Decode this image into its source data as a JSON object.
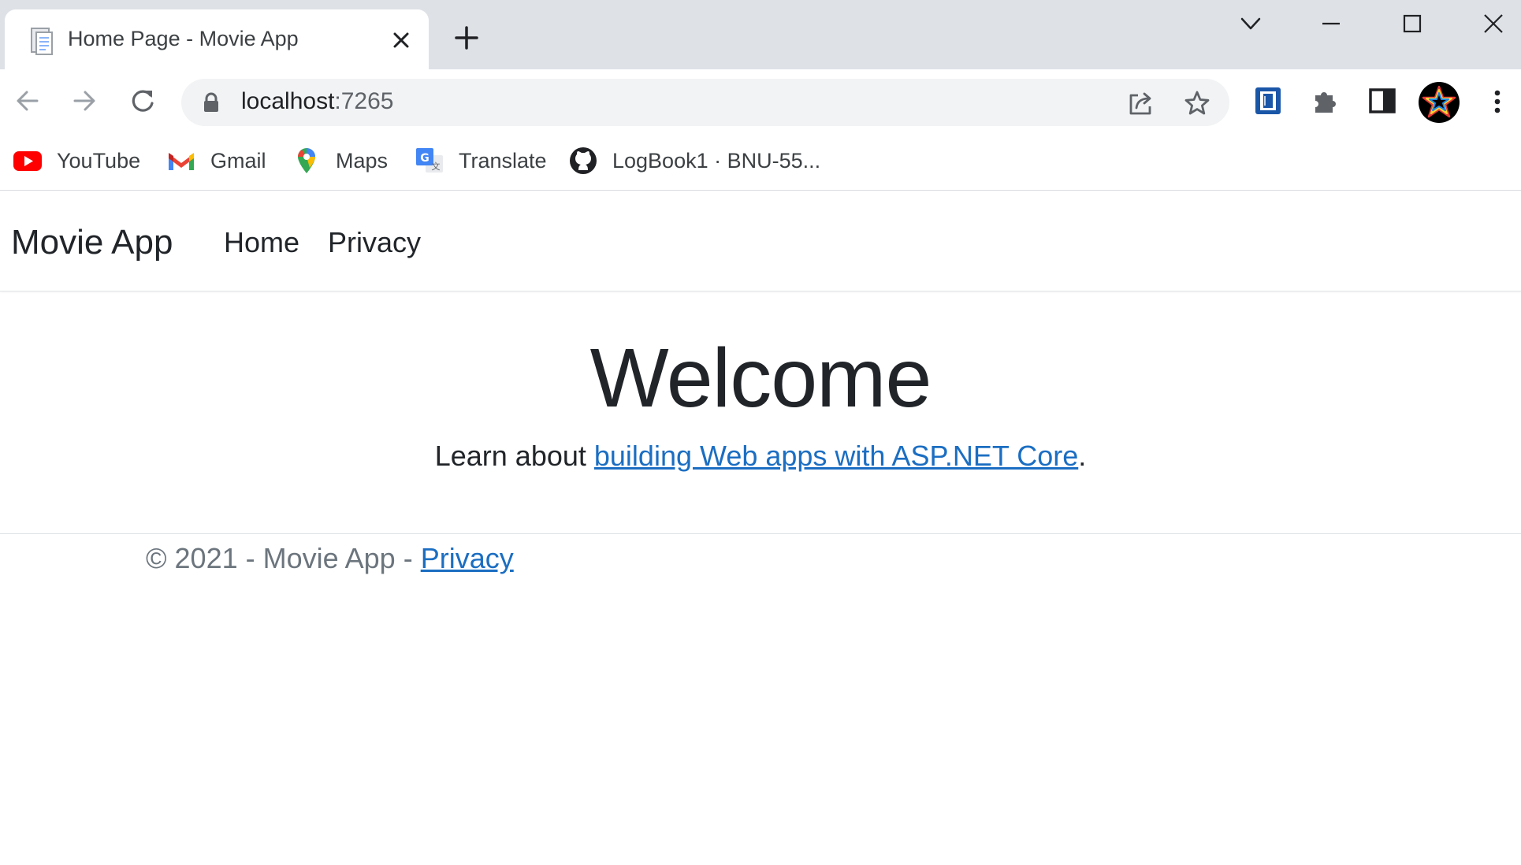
{
  "browser": {
    "tab": {
      "title": "Home Page - Movie App",
      "favicon": "document-icon"
    },
    "window_controls": [
      "tab-search-icon",
      "minimize-icon",
      "maximize-icon",
      "close-icon"
    ],
    "address_bar": {
      "host": "localhost",
      "port": ":7265"
    },
    "bookmarks": [
      {
        "label": "YouTube",
        "icon": "youtube-icon"
      },
      {
        "label": "Gmail",
        "icon": "gmail-icon"
      },
      {
        "label": "Maps",
        "icon": "maps-icon"
      },
      {
        "label": "Translate",
        "icon": "translate-icon"
      },
      {
        "label": "LogBook1 · BNU-55...",
        "icon": "github-icon"
      }
    ]
  },
  "site": {
    "brand": "Movie App",
    "nav": [
      {
        "label": "Home"
      },
      {
        "label": "Privacy"
      }
    ],
    "heading": "Welcome",
    "intro": {
      "prefix": "Learn about ",
      "link_text": "building Web apps with ASP.NET Core",
      "suffix": "."
    },
    "footer": {
      "text": "© 2021 - Movie App - ",
      "link_text": "Privacy"
    }
  },
  "colors": {
    "tabstrip_bg": "#dee1e6",
    "omnibox_bg": "#f1f3f4",
    "link": "#1b6ec2",
    "text": "#212529",
    "muted": "#6c757d"
  }
}
